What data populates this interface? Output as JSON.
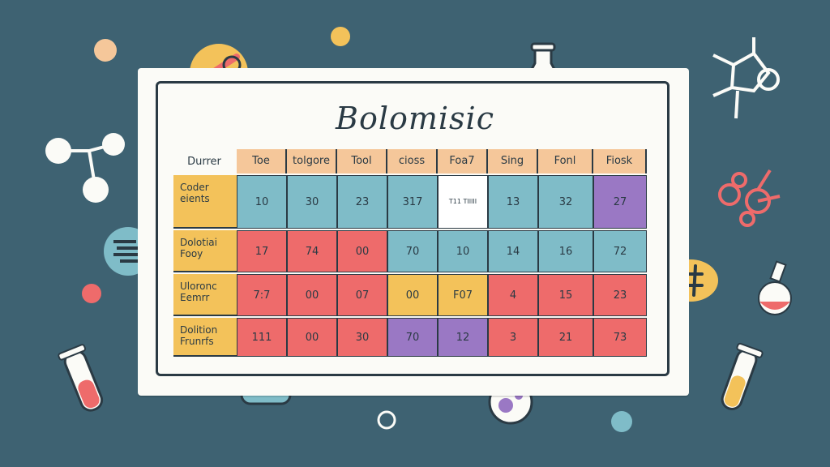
{
  "title": "Bolomisic",
  "corner_label": "Durrer",
  "columns": [
    "Toe",
    "tolgore",
    "Tool",
    "cioss",
    "Foa7",
    "Sing",
    "Fonl",
    "Fiosk"
  ],
  "rows": [
    {
      "label": "Coder eients",
      "cells": [
        {
          "text": "10",
          "color": "#7fbcc8"
        },
        {
          "text": "30",
          "color": "#7fbcc8"
        },
        {
          "text": "23",
          "color": "#7fbcc8"
        },
        {
          "text": "317",
          "color": "#7fbcc8"
        },
        {
          "text": "T11 TIIIII",
          "color": "#ffffff",
          "small": true
        },
        {
          "text": "13",
          "color": "#7fbcc8"
        },
        {
          "text": "32",
          "color": "#7fbcc8"
        },
        {
          "text": "27",
          "color": "#9a78c4"
        }
      ]
    },
    {
      "label": "Dolotiai Fooy",
      "cells": [
        {
          "text": "17",
          "color": "#ee6b6b"
        },
        {
          "text": "74",
          "color": "#ee6b6b"
        },
        {
          "text": "00",
          "color": "#ee6b6b"
        },
        {
          "text": "70",
          "color": "#7fbcc8"
        },
        {
          "text": "10",
          "color": "#7fbcc8"
        },
        {
          "text": "14",
          "color": "#7fbcc8"
        },
        {
          "text": "16",
          "color": "#7fbcc8"
        },
        {
          "text": "72",
          "color": "#7fbcc8"
        }
      ]
    },
    {
      "label": "Uloronc Eemrr",
      "cells": [
        {
          "text": "7:7",
          "color": "#ee6b6b"
        },
        {
          "text": "00",
          "color": "#ee6b6b"
        },
        {
          "text": "07",
          "color": "#ee6b6b"
        },
        {
          "text": "00",
          "color": "#f3c25a"
        },
        {
          "text": "F07",
          "color": "#f3c25a"
        },
        {
          "text": "4",
          "color": "#ee6b6b"
        },
        {
          "text": "15",
          "color": "#ee6b6b"
        },
        {
          "text": "23",
          "color": "#ee6b6b"
        }
      ]
    },
    {
      "label": "Dolition Frunrfs",
      "cells": [
        {
          "text": "111",
          "color": "#ee6b6b"
        },
        {
          "text": "00",
          "color": "#ee6b6b"
        },
        {
          "text": "30",
          "color": "#ee6b6b"
        },
        {
          "text": "70",
          "color": "#9a78c4"
        },
        {
          "text": "12",
          "color": "#9a78c4"
        },
        {
          "text": "3",
          "color": "#ee6b6b"
        },
        {
          "text": "21",
          "color": "#ee6b6b"
        },
        {
          "text": "73",
          "color": "#ee6b6b"
        }
      ]
    }
  ],
  "colors": {
    "background": "#3e6272",
    "board": "#fbfbf7",
    "header": "#f5c79a",
    "row_header": "#f3c25a",
    "teal": "#7fbcc8",
    "coral": "#ee6b6b",
    "yellow": "#f3c25a",
    "purple": "#9a78c4"
  },
  "decorations": [
    "molecule-icon",
    "flask-icon",
    "test-tube-icon",
    "dna-icon",
    "hash-icon",
    "dot-icon"
  ]
}
